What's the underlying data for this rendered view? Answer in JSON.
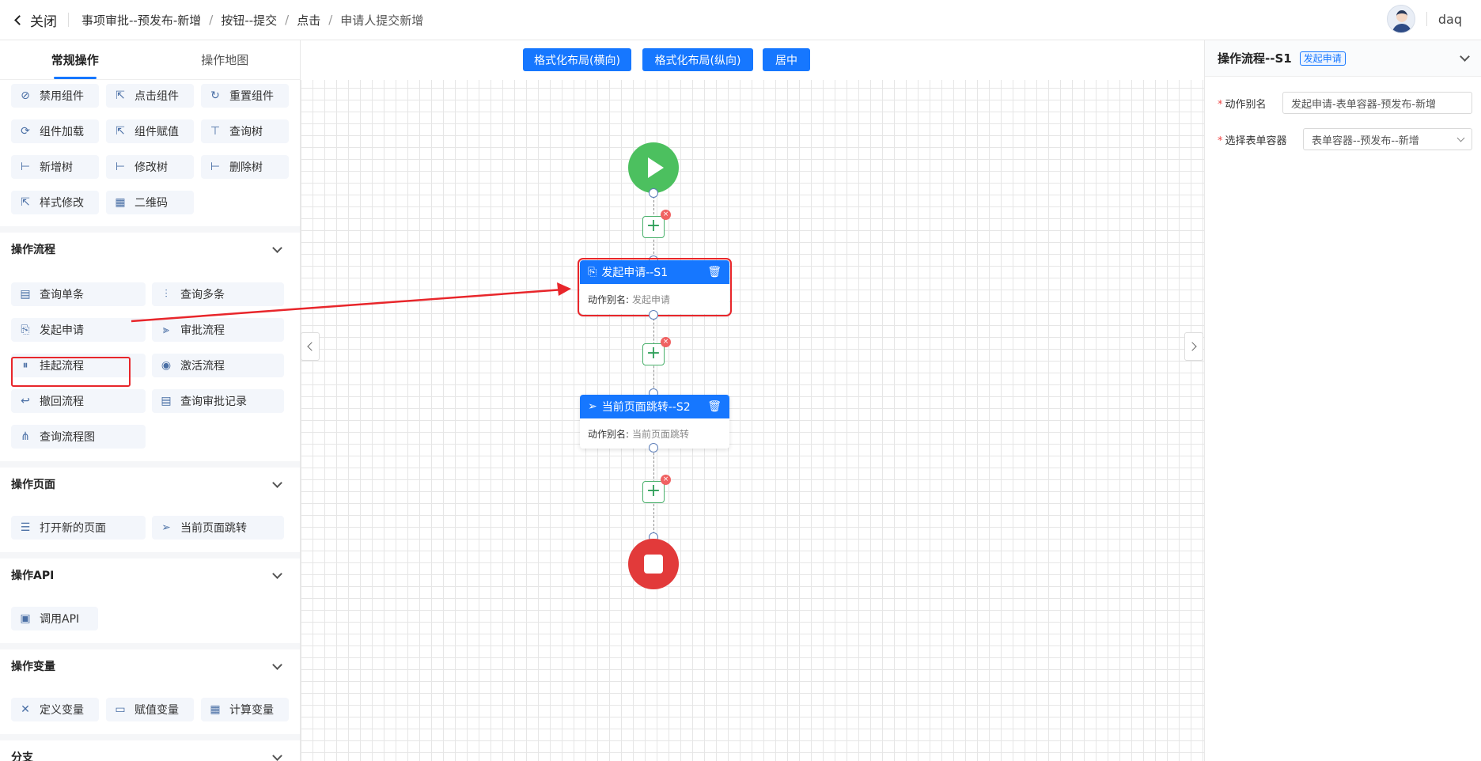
{
  "header": {
    "close_label": "关闭",
    "breadcrumbs": [
      "事项审批--预发布-新增",
      "按钮--提交",
      "点击",
      "申请人提交新增"
    ],
    "separator": "/",
    "username": "daq"
  },
  "left_panel": {
    "tabs": [
      {
        "label": "常规操作",
        "active": true
      },
      {
        "label": "操作地图",
        "active": false
      }
    ],
    "component_items": [
      {
        "label": "禁用组件",
        "icon": "ban-icon"
      },
      {
        "label": "点击组件",
        "icon": "pointer-icon"
      },
      {
        "label": "重置组件",
        "icon": "reset-icon"
      },
      {
        "label": "组件加载",
        "icon": "reload-icon"
      },
      {
        "label": "组件赋值",
        "icon": "pointer-icon"
      },
      {
        "label": "查询树",
        "icon": "tree-icon"
      },
      {
        "label": "新增树",
        "icon": "tree-add-icon"
      },
      {
        "label": "修改树",
        "icon": "tree-edit-icon"
      },
      {
        "label": "删除树",
        "icon": "tree-delete-icon"
      },
      {
        "label": "样式修改",
        "icon": "pointer-icon"
      },
      {
        "label": "二维码",
        "icon": "qrcode-icon"
      }
    ],
    "sections": [
      {
        "title": "操作流程",
        "items": [
          {
            "label": "查询单条",
            "icon": "document-icon"
          },
          {
            "label": "查询多条",
            "icon": "bars-icon"
          },
          {
            "label": "发起申请",
            "icon": "form-submit-icon"
          },
          {
            "label": "审批流程",
            "icon": "flow-icon"
          },
          {
            "label": "挂起流程",
            "icon": "pause-icon"
          },
          {
            "label": "激活流程",
            "icon": "target-icon"
          },
          {
            "label": "撤回流程",
            "icon": "undo-icon"
          },
          {
            "label": "查询审批记录",
            "icon": "record-icon"
          },
          {
            "label": "查询流程图",
            "icon": "diagram-icon"
          }
        ]
      },
      {
        "title": "操作页面",
        "items": [
          {
            "label": "打开新的页面",
            "icon": "list-icon"
          },
          {
            "label": "当前页面跳转",
            "icon": "send-icon"
          }
        ]
      },
      {
        "title": "操作API",
        "items": [
          {
            "label": "调用API",
            "icon": "api-icon"
          }
        ]
      },
      {
        "title": "操作变量",
        "items": [
          {
            "label": "定义变量",
            "icon": "variable-icon"
          },
          {
            "label": "赋值变量",
            "icon": "terminal-icon"
          },
          {
            "label": "计算变量",
            "icon": "calculator-icon"
          }
        ]
      },
      {
        "title": "分支",
        "items": []
      }
    ]
  },
  "canvas": {
    "buttons": [
      "格式化布局(横向)",
      "格式化布局(纵向)",
      "居中"
    ],
    "nodes": [
      {
        "title": "发起申请--S1",
        "alias_label": "动作别名:",
        "alias_value": "发起申请",
        "selected": true
      },
      {
        "title": "当前页面跳转--S2",
        "alias_label": "动作别名:",
        "alias_value": "当前页面跳转",
        "selected": false
      }
    ]
  },
  "right_panel": {
    "title": "操作流程--S1",
    "badge": "发起申请",
    "fields": [
      {
        "label": "动作别名",
        "required": true,
        "value": "发起申请-表单容器-预发布-新增",
        "type": "input"
      },
      {
        "label": "选择表单容器",
        "required": true,
        "value": "表单容器--预发布--新增",
        "type": "select"
      }
    ]
  },
  "colors": {
    "primary": "#1677ff",
    "start": "#4cc05f",
    "end": "#e23a3a",
    "highlight": "#e8262b"
  }
}
